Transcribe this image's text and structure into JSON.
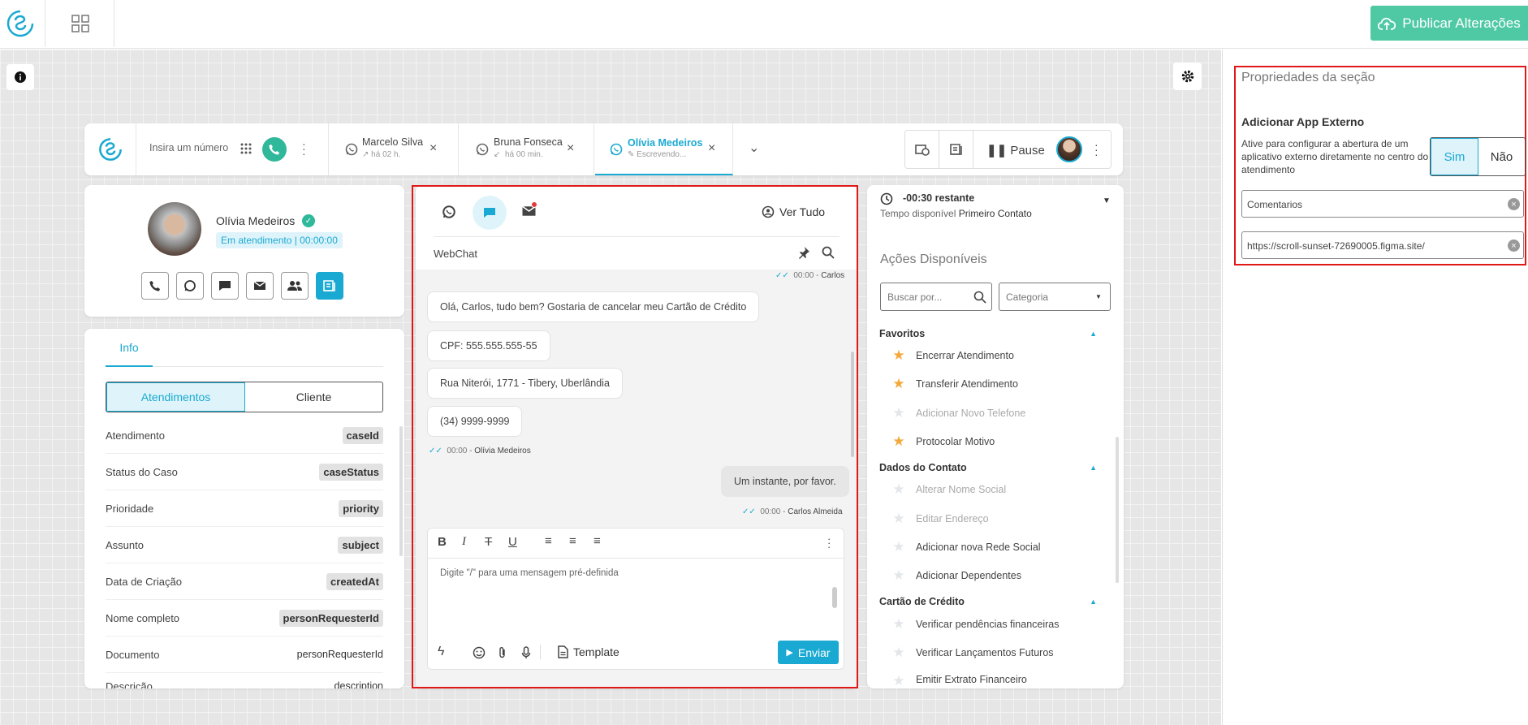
{
  "topbar": {
    "publish_label": "Publicar Alterações"
  },
  "dialer": {
    "placeholder": "Insira um número"
  },
  "tabs": [
    {
      "name": "Marcelo Silva",
      "sub": "há 02 h."
    },
    {
      "name": "Bruna Fonseca",
      "sub": "há 00 min."
    },
    {
      "name": "Olívia Medeiros",
      "sub": "Escrevendo..."
    }
  ],
  "toolbar": {
    "pause_label": "Pause"
  },
  "contact": {
    "name": "Olívia Medeiros",
    "status": "Em atendimento | 00:00:00"
  },
  "info": {
    "tab_label": "Info",
    "toggle": {
      "left": "Atendimentos",
      "right": "Cliente"
    },
    "rows": [
      {
        "label": "Atendimento",
        "value": "caseId"
      },
      {
        "label": "Status do Caso",
        "value": "caseStatus"
      },
      {
        "label": "Prioridade",
        "value": "priority"
      },
      {
        "label": "Assunto",
        "value": "subject"
      },
      {
        "label": "Data de Criação",
        "value": "createdAt"
      },
      {
        "label": "Nome completo",
        "value": "personRequesterId"
      },
      {
        "label": "Documento",
        "value": "personRequesterId"
      },
      {
        "label": "Descrição",
        "value": "description"
      }
    ]
  },
  "chat": {
    "ver_tudo": "Ver Tudo",
    "channel": "WebChat",
    "top_meta": {
      "time": "00:00",
      "sender": "Carlos"
    },
    "messages": [
      "Olá, Carlos, tudo bem? Gostaria de cancelar meu Cartão de Crédito",
      "CPF: 555.555.555-55",
      "Rua Niterói, 1771 - Tibery, Uberlândia",
      "(34) 9999-9999"
    ],
    "client_meta": {
      "time": "00:00",
      "sender": "Olívia Medeiros"
    },
    "agent_message": "Um instante, por favor.",
    "agent_meta": {
      "time": "00:00",
      "sender": "Carlos Almeida"
    },
    "placeholder": "Digite \"/\" para uma mensagem pré-definida",
    "template_label": "Template",
    "send_label": "Enviar"
  },
  "actions": {
    "timer": "-00:30 restante",
    "timer_sub_prefix": "Tempo disponível",
    "timer_sub_bold": "Primeiro Contato",
    "title": "Ações Disponíveis",
    "search_placeholder": "Buscar por...",
    "category_placeholder": "Categoria",
    "sections": [
      {
        "title": "Favoritos",
        "items": [
          {
            "label": "Encerrar Atendimento",
            "starred": true,
            "disabled": false
          },
          {
            "label": "Transferir Atendimento",
            "starred": true,
            "disabled": false
          },
          {
            "label": "Adicionar Novo Telefone",
            "starred": false,
            "disabled": true
          },
          {
            "label": "Protocolar Motivo",
            "starred": true,
            "disabled": false
          }
        ]
      },
      {
        "title": "Dados do Contato",
        "items": [
          {
            "label": "Alterar Nome Social",
            "starred": false,
            "disabled": true
          },
          {
            "label": "Editar Endereço",
            "starred": false,
            "disabled": true
          },
          {
            "label": "Adicionar nova Rede Social",
            "starred": false,
            "disabled": false
          },
          {
            "label": "Adicionar Dependentes",
            "starred": false,
            "disabled": false
          }
        ]
      },
      {
        "title": "Cartão de Crédito",
        "items": [
          {
            "label": "Verificar pendências financeiras",
            "starred": false,
            "disabled": false
          },
          {
            "label": "Verificar Lançamentos Futuros",
            "starred": false,
            "disabled": false
          },
          {
            "label": "Emitir Extrato Financeiro",
            "starred": false,
            "disabled": false
          }
        ]
      }
    ]
  },
  "properties": {
    "title": "Propriedades da seção",
    "subtitle": "Adicionar App Externo",
    "description": "Ative para configurar a abertura de um aplicativo externo diretamente no centro do atendimento",
    "yes": "Sim",
    "no": "Não",
    "field1": "Comentarios",
    "field2": "https://scroll-sunset-72690005.figma.site/"
  },
  "colors": {
    "accent": "#1aa9d2",
    "publish": "#4fc9a4",
    "active_phone": "#2fb89a",
    "highlight": "#e01818"
  }
}
